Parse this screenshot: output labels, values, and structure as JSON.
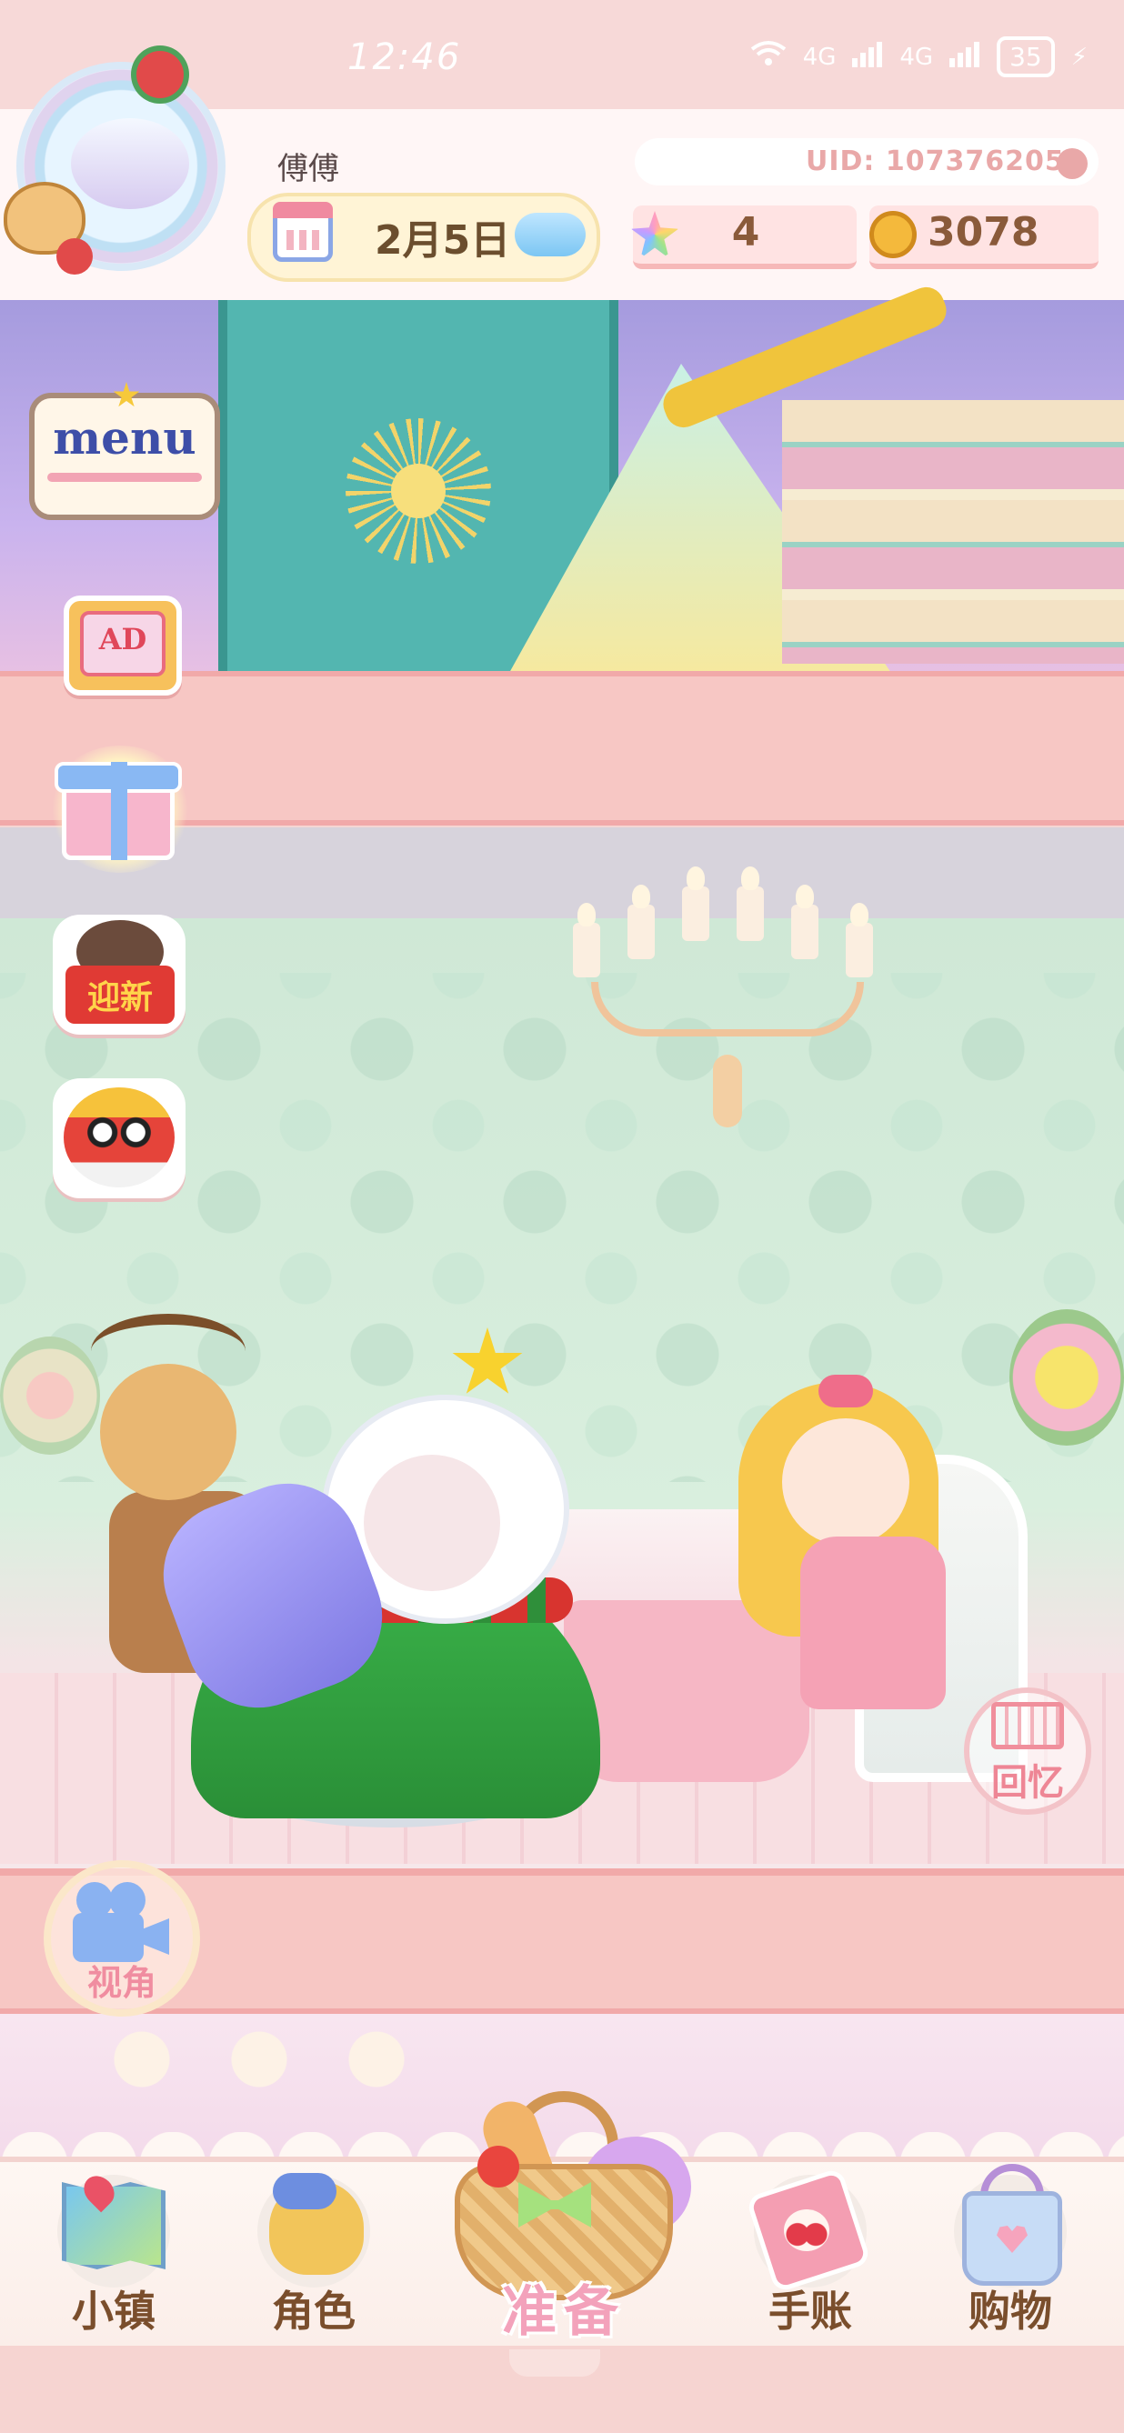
{
  "status_bar": {
    "time": "12:46",
    "network_1": "4G",
    "network_2": "4G",
    "battery": "35"
  },
  "header": {
    "player_name": "傅傅",
    "date": "2月5日",
    "uid": "UID: 1073762050",
    "gems": "4",
    "coins": "3078"
  },
  "side_buttons": {
    "menu_label": "menu",
    "ad_label": "AD",
    "newyear_sign": "迎新"
  },
  "scene_buttons": {
    "memory_label": "回忆",
    "view_label": "视角"
  },
  "bottom_nav": {
    "town": "小镇",
    "role": "角色",
    "prepare": "准备",
    "journal": "手账",
    "shop": "购物"
  },
  "icons": {
    "calendar": "calendar-icon",
    "weather": "cloud-icon",
    "gem": "rainbow-star-icon",
    "coin": "gold-coin-icon",
    "copy": "copy-icon",
    "camera": "movie-camera-icon",
    "film": "film-strip-icon"
  },
  "colors": {
    "theme_pink": "#f7c7c4",
    "nav_text": "#7a4e2c",
    "uid_text": "#e9a8a8",
    "accent_pink": "#f08da0"
  }
}
